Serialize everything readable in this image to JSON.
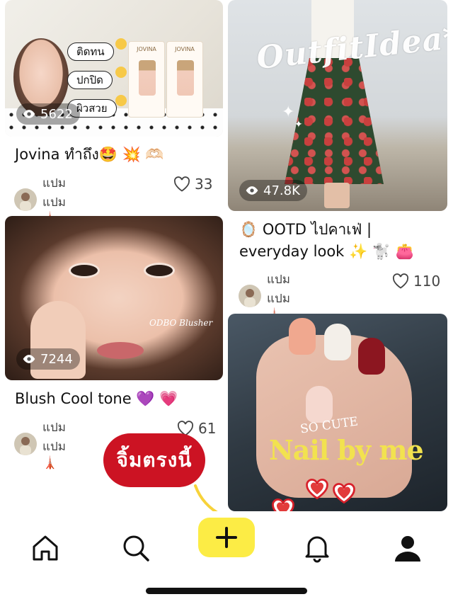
{
  "feed": {
    "posts": [
      {
        "title": "Jovina ทำถึง🤩 💥 🫶🏻",
        "views": "5622",
        "author": "แปมแปม🗼",
        "likes": "33",
        "image": {
          "pills": [
            "ติดทน",
            "ปกปิด",
            "ผิวสวย"
          ],
          "product_brand": "JOVINA"
        }
      },
      {
        "title": "🪞 OOTD ไปคาเฟ่ |",
        "title_line2": "everyday look ✨ 🐩 👛",
        "views": "47.8K",
        "author": "แปมแปม🗼",
        "likes": "110",
        "image": {
          "overlay_text": "OutfitIdea*"
        }
      },
      {
        "title": "Blush Cool tone 💜 💗",
        "views": "7244",
        "author": "แปมแปม🗼",
        "likes": "61",
        "image": {
          "watermark": "ODBO Blusher"
        }
      },
      {
        "image": {
          "overlay_text": "Nail by me",
          "small_text": "SO CUTE"
        }
      }
    ]
  },
  "overlay": {
    "cta_label": "จิ้มตรงนี้"
  },
  "bottom_nav": {
    "items": [
      {
        "icon": "home-icon"
      },
      {
        "icon": "search-icon"
      },
      {
        "icon": "plus-icon"
      },
      {
        "icon": "bell-icon"
      },
      {
        "icon": "profile-icon"
      }
    ],
    "plus_color": "#fcec45"
  },
  "colors": {
    "cta_red": "#cc1323",
    "accent_yellow": "#fcec45"
  }
}
